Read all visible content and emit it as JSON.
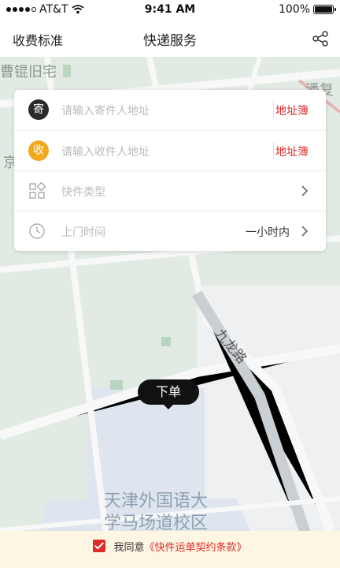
{
  "status_bar": {
    "carrier": "AT&T",
    "time": "9:41 AM",
    "battery": "100%"
  },
  "navbar": {
    "left_button": "收费标准",
    "title": "快递服务",
    "share_icon": "share-icon"
  },
  "map": {
    "labels": [
      "曹锟旧宅",
      "潘复",
      "京",
      "九龙路",
      "天津外国语大学马场道校区"
    ],
    "campus_line1": "天津外国语大",
    "campus_line2": "学马场道校区"
  },
  "form": {
    "sender": {
      "badge": "寄",
      "placeholder": "请输入寄件人地址",
      "action": "地址簿"
    },
    "receiver": {
      "badge": "收",
      "placeholder": "请输入收件人地址",
      "action": "地址簿"
    },
    "package_type": {
      "label": "快件类型",
      "icon": "grid-icon"
    },
    "pickup_time": {
      "label": "上门时间",
      "value": "一小时内",
      "icon": "clock-icon"
    }
  },
  "order_button": "下单",
  "agreement": {
    "prefix": "我同意",
    "link": "《快件运单契约条款》",
    "checked": true
  },
  "colors": {
    "accent": "#e02a2a",
    "receiver_badge": "#f2a81d",
    "sender_badge": "#2b2b2b"
  }
}
